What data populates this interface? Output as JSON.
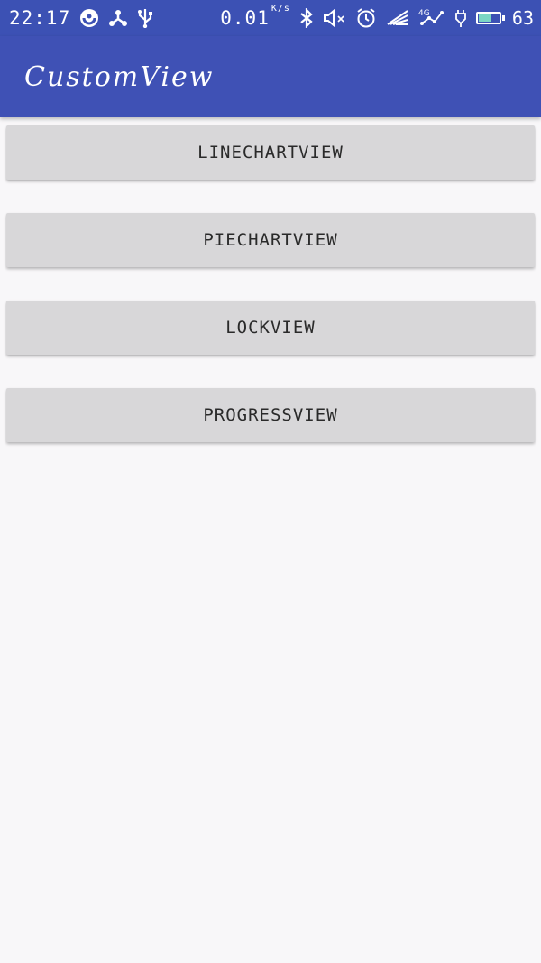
{
  "status_bar": {
    "time": "22:17",
    "network_speed": "0.01",
    "network_speed_unit": "K/s",
    "network_type": "4G",
    "battery_percent": "63",
    "battery_level": 0.63,
    "left_icons": [
      "sync-circle-icon",
      "share-icon",
      "usb-icon"
    ],
    "right_icons": [
      "bluetooth-icon",
      "volume-mute-icon",
      "alarm-icon",
      "signal-wings-icon",
      "mobile-data-4g-icon",
      "charging-icon",
      "battery-icon"
    ],
    "background_color": "#3c51b4"
  },
  "app_bar": {
    "title": "CustomView",
    "background_color": "#3f51b5",
    "title_color": "#ffffff"
  },
  "buttons": [
    {
      "label": "LINECHARTVIEW"
    },
    {
      "label": "PIECHARTVIEW"
    },
    {
      "label": "LOCKVIEW"
    },
    {
      "label": "PROGRESSVIEW"
    }
  ],
  "colors": {
    "page_background": "#f8f7f9",
    "button_background": "#d8d7d9",
    "button_text": "#2a2a2a",
    "battery_fill": "#7bd6c4"
  }
}
